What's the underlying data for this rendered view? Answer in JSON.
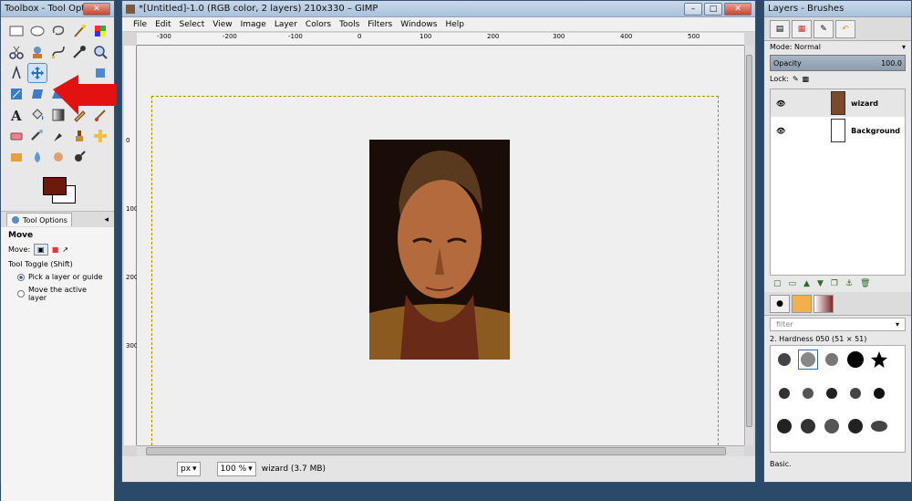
{
  "toolbox": {
    "title": "Toolbox - Tool Options",
    "tool_options_tab": "Tool Options",
    "tool_name": "Move",
    "move_label": "Move:",
    "tool_toggle": "Tool Toggle  (Shift)",
    "option_pick": "Pick a layer or guide",
    "option_active": "Move the active layer",
    "fg_color": "#6b1a0e",
    "bg_color": "#ffffff"
  },
  "image_window": {
    "title": "*[Untitled]-1.0 (RGB color, 2 layers) 210x330 – GIMP",
    "menus": [
      "File",
      "Edit",
      "Select",
      "View",
      "Image",
      "Layer",
      "Colors",
      "Tools",
      "Filters",
      "Windows",
      "Help"
    ],
    "ruler_labels": [
      "-300",
      "-200",
      "-100",
      "0",
      "100",
      "200",
      "300",
      "400",
      "500"
    ],
    "vruler_labels": [
      "0",
      "100",
      "200",
      "300"
    ],
    "status": {
      "unit": "px",
      "zoom": "100 %",
      "info": "wizard (3.7 MB)"
    }
  },
  "layers_panel": {
    "title": "Layers - Brushes",
    "mode_label": "Mode: Normal",
    "opacity_label": "Opacity",
    "opacity_value": "100.0",
    "lock_label": "Lock:",
    "layers": [
      {
        "name": "wizard"
      },
      {
        "name": "Background"
      }
    ],
    "brush_filter": "filter",
    "brush_name": "2. Hardness 050 (51 × 51)",
    "brush_preset": "Basic."
  }
}
